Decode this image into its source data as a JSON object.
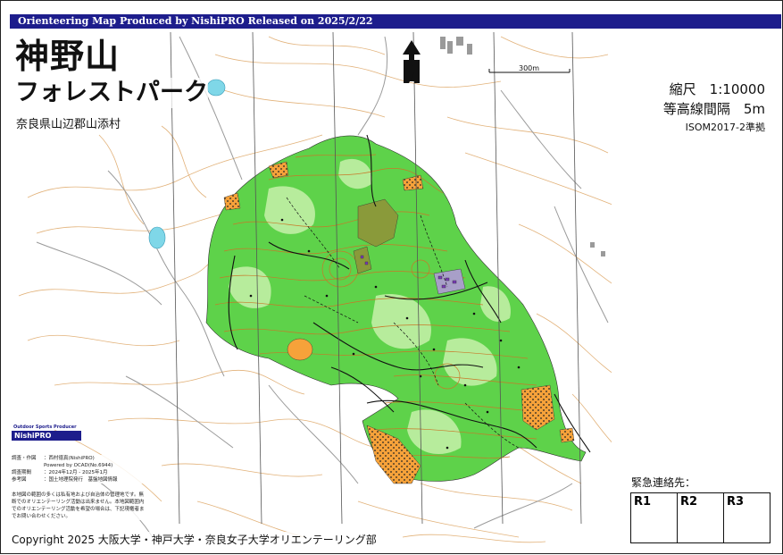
{
  "banner": "Orienteering Map Produced by NishiPRO Released on 2025/2/22",
  "title": {
    "main": "神野山",
    "sub": "フォレストパーク"
  },
  "location": "奈良県山辺郡山添村",
  "scale": "縮尺　1:10000",
  "contour_interval": "等高線間隔　5m",
  "standard": "ISOM2017-2準拠",
  "scale_bar": "300m",
  "logo": {
    "tagline": "Outdoor Sports Producer",
    "name": "NishiPRO"
  },
  "credits": [
    {
      "key": "調査・作図",
      "value": "：西村徳真(NishiPRO)"
    },
    {
      "key": "",
      "value": "Powered by OCAD(No.6944)"
    },
    {
      "key": "調査期間",
      "value": "：2024年12月 - 2025年1月"
    },
    {
      "key": "参考図",
      "value": "：国土地理院発行　基盤地図情報"
    }
  ],
  "notice": "本地図の範囲の多くは私有地および自治体の管理地です。無断でのオリエンテーリング活動は出来ません。本地図範囲内でのオリエンテーリング活動を希望の場合は、下記現権者までお問い合わせください。",
  "emergency_label": "緊急連絡先：",
  "registers": [
    "R1",
    "R2",
    "R3"
  ],
  "copyright": "Copyright 2025 大阪大学・神戸大学・奈良女子大学オリエンテーリング部",
  "colors": {
    "banner": "#1d1d8c",
    "forest_green": "#5ed24a",
    "light_green": "#b7ec9c",
    "contour_brown": "#c87828",
    "open_yellow": "#f6a23a",
    "olive": "#8a9a3a",
    "purple": "#7a3ab8"
  }
}
